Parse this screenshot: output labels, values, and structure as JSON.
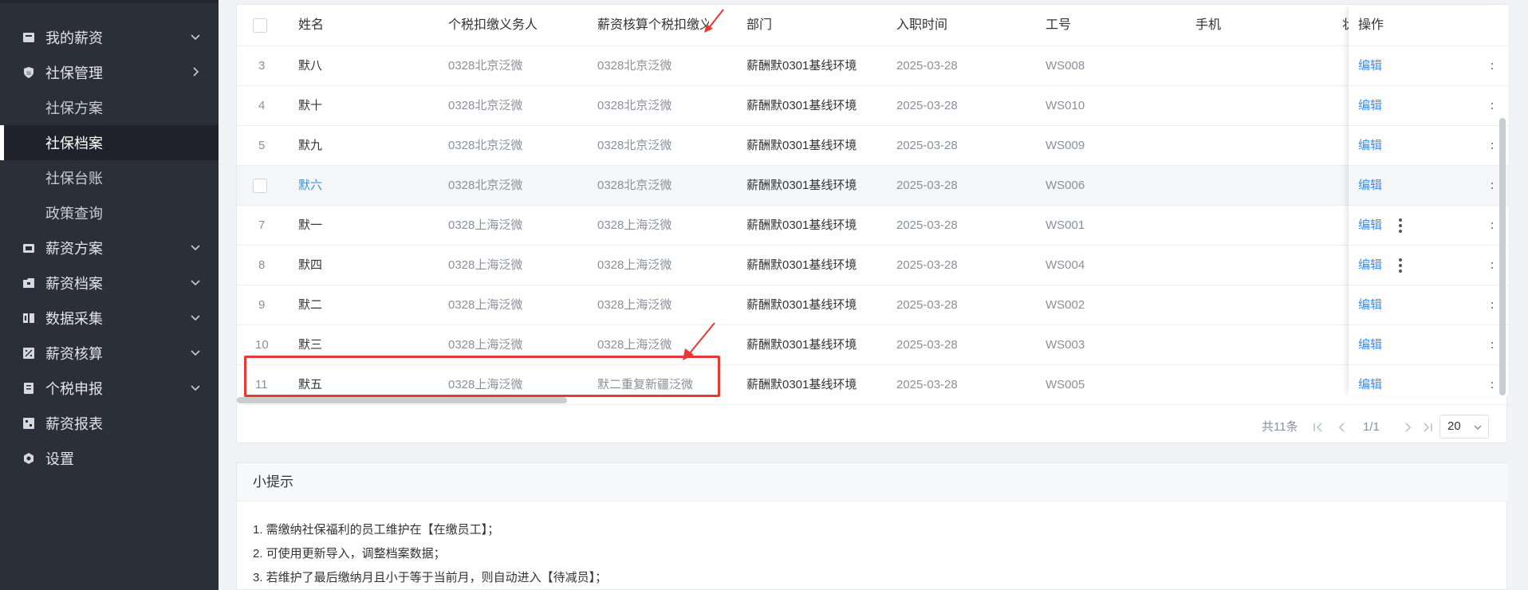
{
  "sidebar": {
    "items": [
      {
        "label": "我的薪资",
        "icon": "wallet-icon",
        "chevron": "down"
      },
      {
        "label": "社保管理",
        "icon": "shield-icon",
        "chevron": "right"
      },
      {
        "label": "薪资方案",
        "icon": "folder-icon",
        "chevron": "down"
      },
      {
        "label": "薪资档案",
        "icon": "archive-icon",
        "chevron": "down"
      },
      {
        "label": "数据采集",
        "icon": "data-icon",
        "chevron": "down"
      },
      {
        "label": "薪资核算",
        "icon": "calculator-icon",
        "chevron": "down"
      },
      {
        "label": "个税申报",
        "icon": "tax-icon",
        "chevron": "down"
      },
      {
        "label": "薪资报表",
        "icon": "report-icon",
        "chevron": ""
      },
      {
        "label": "设置",
        "icon": "gear-icon",
        "chevron": ""
      }
    ],
    "subitems": [
      {
        "label": "社保方案"
      },
      {
        "label": "社保档案",
        "active": true
      },
      {
        "label": "社保台账"
      },
      {
        "label": "政策查询"
      }
    ]
  },
  "table": {
    "headers": {
      "name": "姓名",
      "tax_agent": "个税扣缴义务人",
      "calc_agent": "薪资核算个税扣缴义",
      "dept": "部门",
      "join_date": "入职时间",
      "emp_no": "工号",
      "phone": "手机",
      "truncated": "状",
      "action": "操作"
    },
    "rows": [
      {
        "index": "3",
        "name": "默八",
        "tax_agent": "0328北京泛微",
        "calc_agent": "0328北京泛微",
        "dept": "薪酬默0301基线环境",
        "join_date": "2025-03-28",
        "emp_no": "WS008",
        "phone": "",
        "action": "编辑"
      },
      {
        "index": "4",
        "name": "默十",
        "tax_agent": "0328北京泛微",
        "calc_agent": "0328北京泛微",
        "dept": "薪酬默0301基线环境",
        "join_date": "2025-03-28",
        "emp_no": "WS010",
        "phone": "",
        "action": "编辑"
      },
      {
        "index": "5",
        "name": "默九",
        "tax_agent": "0328北京泛微",
        "calc_agent": "0328北京泛微",
        "dept": "薪酬默0301基线环境",
        "join_date": "2025-03-28",
        "emp_no": "WS009",
        "phone": "",
        "action": "编辑"
      },
      {
        "index": "",
        "name": "默六",
        "tax_agent": "0328北京泛微",
        "calc_agent": "0328北京泛微",
        "dept": "薪酬默0301基线环境",
        "join_date": "2025-03-28",
        "emp_no": "WS006",
        "phone": "",
        "action": "编辑"
      },
      {
        "index": "7",
        "name": "默一",
        "tax_agent": "0328上海泛微",
        "calc_agent": "0328上海泛微",
        "dept": "薪酬默0301基线环境",
        "join_date": "2025-03-28",
        "emp_no": "WS001",
        "phone": "",
        "action": "编辑"
      },
      {
        "index": "8",
        "name": "默四",
        "tax_agent": "0328上海泛微",
        "calc_agent": "0328上海泛微",
        "dept": "薪酬默0301基线环境",
        "join_date": "2025-03-28",
        "emp_no": "WS004",
        "phone": "",
        "action": "编辑"
      },
      {
        "index": "9",
        "name": "默二",
        "tax_agent": "0328上海泛微",
        "calc_agent": "0328上海泛微",
        "dept": "薪酬默0301基线环境",
        "join_date": "2025-03-28",
        "emp_no": "WS002",
        "phone": "",
        "action": "编辑"
      },
      {
        "index": "10",
        "name": "默三",
        "tax_agent": "0328上海泛微",
        "calc_agent": "0328上海泛微",
        "dept": "薪酬默0301基线环境",
        "join_date": "2025-03-28",
        "emp_no": "WS003",
        "phone": "",
        "action": "编辑"
      },
      {
        "index": "11",
        "name": "默五",
        "tax_agent": "0328上海泛微",
        "calc_agent": "默二重复新疆泛微",
        "dept": "薪酬默0301基线环境",
        "join_date": "2025-03-28",
        "emp_no": "WS005",
        "phone": "",
        "action": "编辑"
      }
    ]
  },
  "pagination": {
    "total": "共11条",
    "page": "1/1",
    "page_size": "20"
  },
  "tips": {
    "title": "小提示",
    "lines": [
      "1. 需缴纳社保福利的员工维护在【在缴员工】；",
      "2. 可使用更新导入，调整档案数据；",
      "3. 若维护了最后缴纳月且小于等于当前月，则自动进入【待减员】；"
    ]
  },
  "colors": {
    "sidebar_bg": "#2b2f3a",
    "link": "#3f8ee9",
    "annotation_red": "#e53935"
  }
}
